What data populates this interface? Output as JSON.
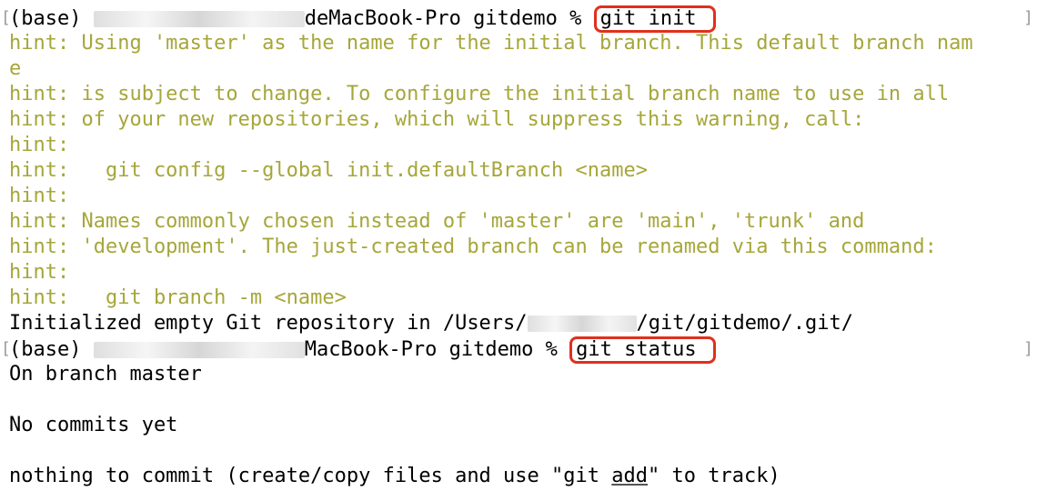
{
  "colors": {
    "hint": "#a6a63a",
    "output": "#000000",
    "highlight_box": "#e0301e",
    "background": "#ffffff"
  },
  "prompt1": {
    "prefix": "(base) ",
    "suffix": "deMacBook-Pro gitdemo % ",
    "command": "git init"
  },
  "hints": [
    "hint: Using 'master' as the name for the initial branch. This default branch nam",
    "e",
    "hint: is subject to change. To configure the initial branch name to use in all",
    "hint: of your new repositories, which will suppress this warning, call:",
    "hint:",
    "hint:   git config --global init.defaultBranch <name>",
    "hint:",
    "hint: Names commonly chosen instead of 'master' are 'main', 'trunk' and",
    "hint: 'development'. The just-created branch can be renamed via this command:",
    "hint:",
    "hint:   git branch -m <name>"
  ],
  "init_output": {
    "prefix": "Initialized empty Git repository in /Users/",
    "suffix": "/git/gitdemo/.git/"
  },
  "prompt2": {
    "prefix": "(base) ",
    "suffix": "MacBook-Pro gitdemo % ",
    "command": "git status"
  },
  "status_output": {
    "branch": "On branch master",
    "commits": "No commits yet",
    "nothing_before": "nothing to commit (create/copy files and use \"git ",
    "nothing_add": "add",
    "nothing_after": "\" to track)"
  }
}
